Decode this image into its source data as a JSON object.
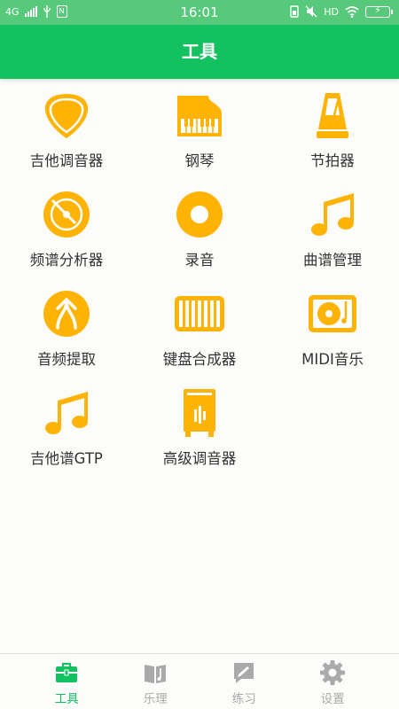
{
  "statusbar": {
    "network": "4G",
    "time": "16:01",
    "hd": "HD"
  },
  "header": {
    "title": "工具"
  },
  "tools": [
    {
      "label": "吉他调音器",
      "icon": "guitar-pick-icon"
    },
    {
      "label": "钢琴",
      "icon": "piano-icon"
    },
    {
      "label": "节拍器",
      "icon": "metronome-icon"
    },
    {
      "label": "频谱分析器",
      "icon": "spectrum-disc-icon"
    },
    {
      "label": "录音",
      "icon": "record-icon"
    },
    {
      "label": "曲谱管理",
      "icon": "music-note-icon"
    },
    {
      "label": "音频提取",
      "icon": "audio-extract-icon"
    },
    {
      "label": "键盘合成器",
      "icon": "keyboard-icon"
    },
    {
      "label": "MIDI音乐",
      "icon": "midi-turntable-icon"
    },
    {
      "label": "吉他谱GTP",
      "icon": "music-note-icon"
    },
    {
      "label": "高级调音器",
      "icon": "advanced-tuner-icon"
    }
  ],
  "tabbar": {
    "items": [
      {
        "label": "工具",
        "icon": "toolbox-icon",
        "active": true
      },
      {
        "label": "乐理",
        "icon": "book-icon",
        "active": false
      },
      {
        "label": "练习",
        "icon": "pencil-note-icon",
        "active": false
      },
      {
        "label": "设置",
        "icon": "gear-icon",
        "active": false
      }
    ]
  },
  "colors": {
    "primary": "#13c160",
    "statusbar": "#57c97a",
    "icon_accent": "#ffb405",
    "tab_inactive": "#aaaaaa"
  }
}
